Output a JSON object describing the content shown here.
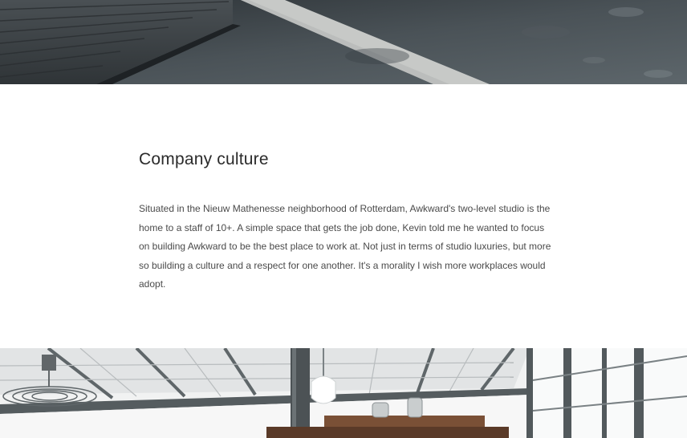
{
  "article": {
    "heading": "Company culture",
    "body": "Situated in the Nieuw Mathenesse neighborhood of Rotterdam, Awkward's two-level studio is the home to a staff of 10+. A simple space that gets the job done, Kevin told me he wanted to focus on building Awkward to be the best place to work at. Not just in terms of studio luxuries, but more so building a culture and a respect for one another. It's a morality I wish more workplaces would adopt."
  },
  "images": {
    "top": "studio-floor-photo",
    "bottom": "studio-interior-photo"
  }
}
